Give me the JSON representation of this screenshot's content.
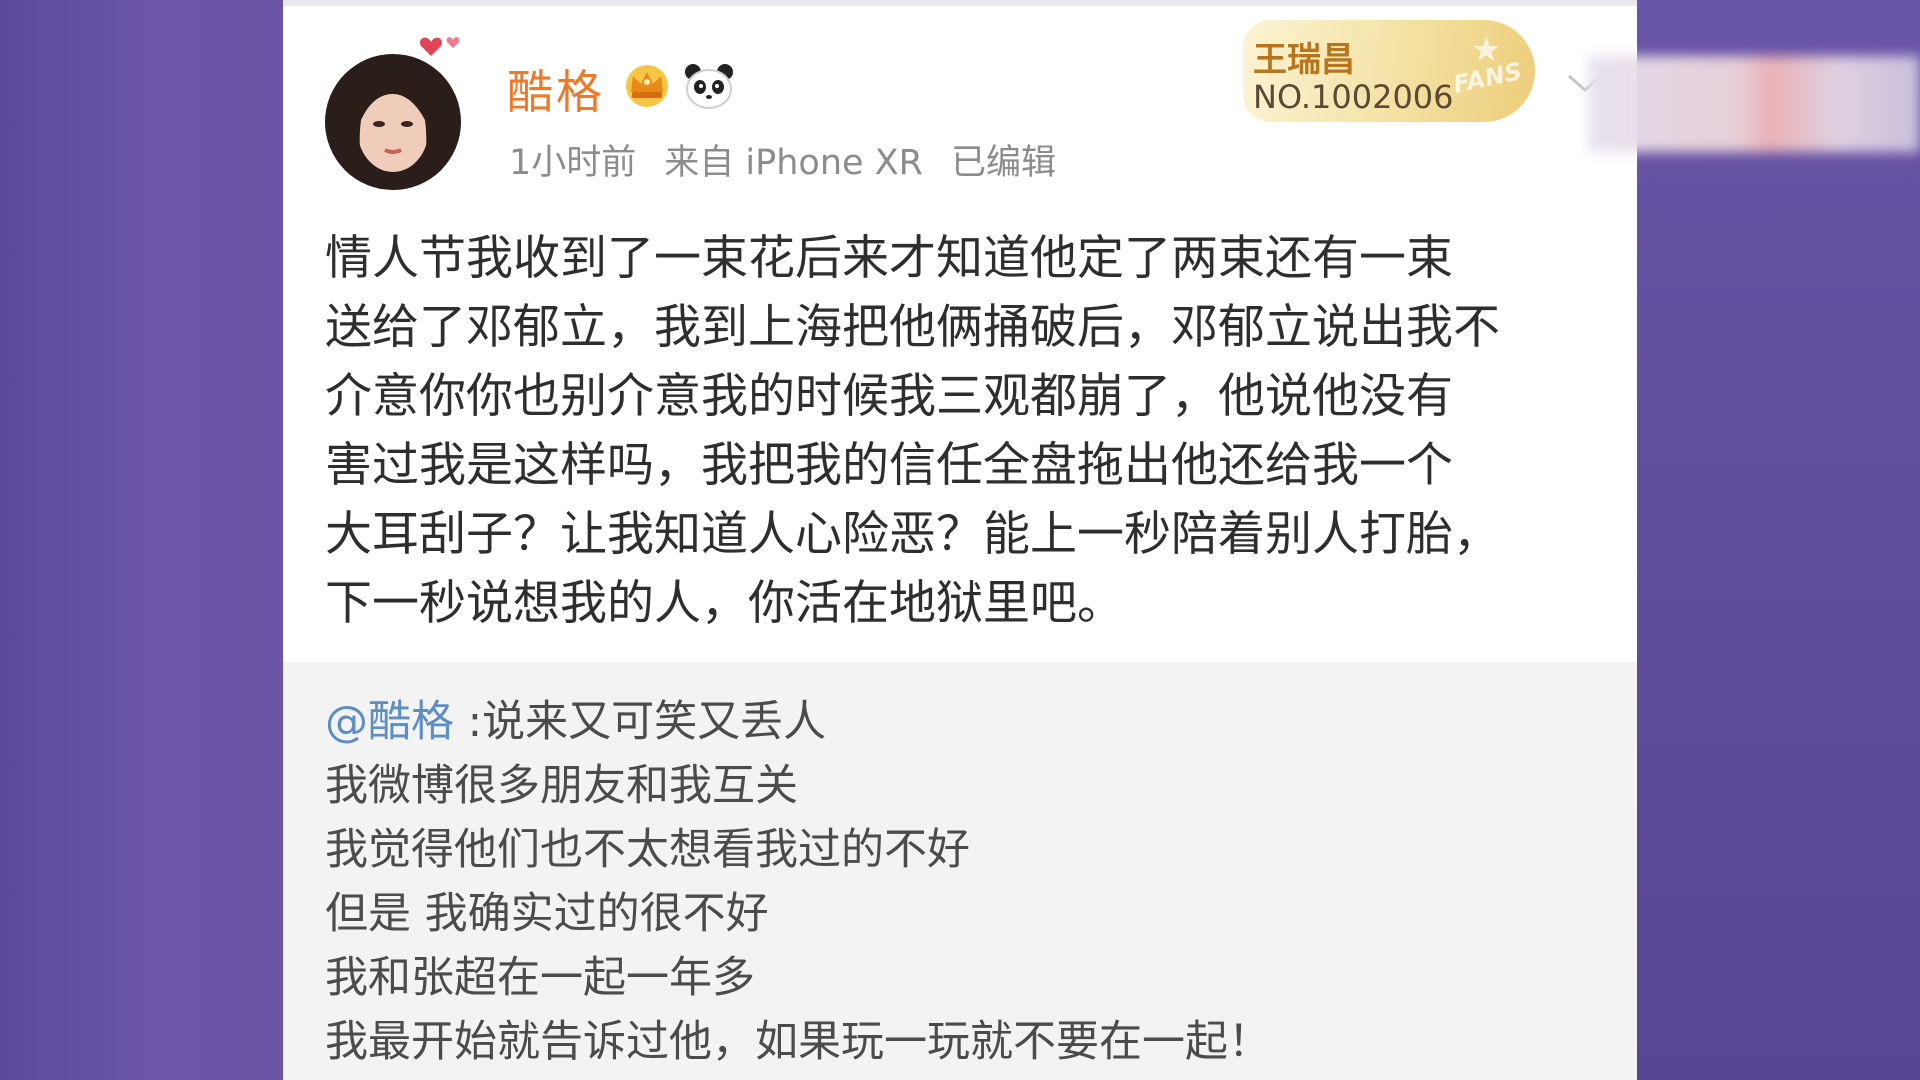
{
  "post": {
    "author": "酷格",
    "time": "1小时前",
    "source": "来自 iPhone XR",
    "edited": "已编辑",
    "fans_badge": {
      "name": "王瑞昌",
      "number": "NO.1002006",
      "mark": "FANS"
    },
    "body_lines": [
      "情人节我收到了一束花后来才知道他定了两束还有一束",
      "送给了邓郁立，我到上海把他俩捅破后，邓郁立说出我不",
      "介意你你也别介意我的时候我三观都崩了，他说他没有",
      "害过我是这样吗，我把我的信任全盘拖出他还给我一个",
      "大耳刮子？让我知道人心险恶？能上一秒陪着别人打胎，",
      "下一秒说想我的人，你活在地狱里吧。"
    ]
  },
  "repost": {
    "mention": "@酷格",
    "first_line": " :说来又可笑又丢人",
    "lines": [
      "我微博很多朋友和我互关",
      "我觉得他们也不太想看我过的不好",
      "但是 我确实过的很不好",
      "我和张超在一起一年多",
      "我最开始就告诉过他，如果玩一玩就不要在一起！"
    ]
  },
  "colors": {
    "username": "#eb7b2a",
    "mention": "#5b8ec5",
    "background": "#6a55a6"
  },
  "icons": [
    "heart-deco-icon",
    "crown-icon",
    "panda-icon",
    "chevron-down-icon",
    "fans-star-icon"
  ]
}
